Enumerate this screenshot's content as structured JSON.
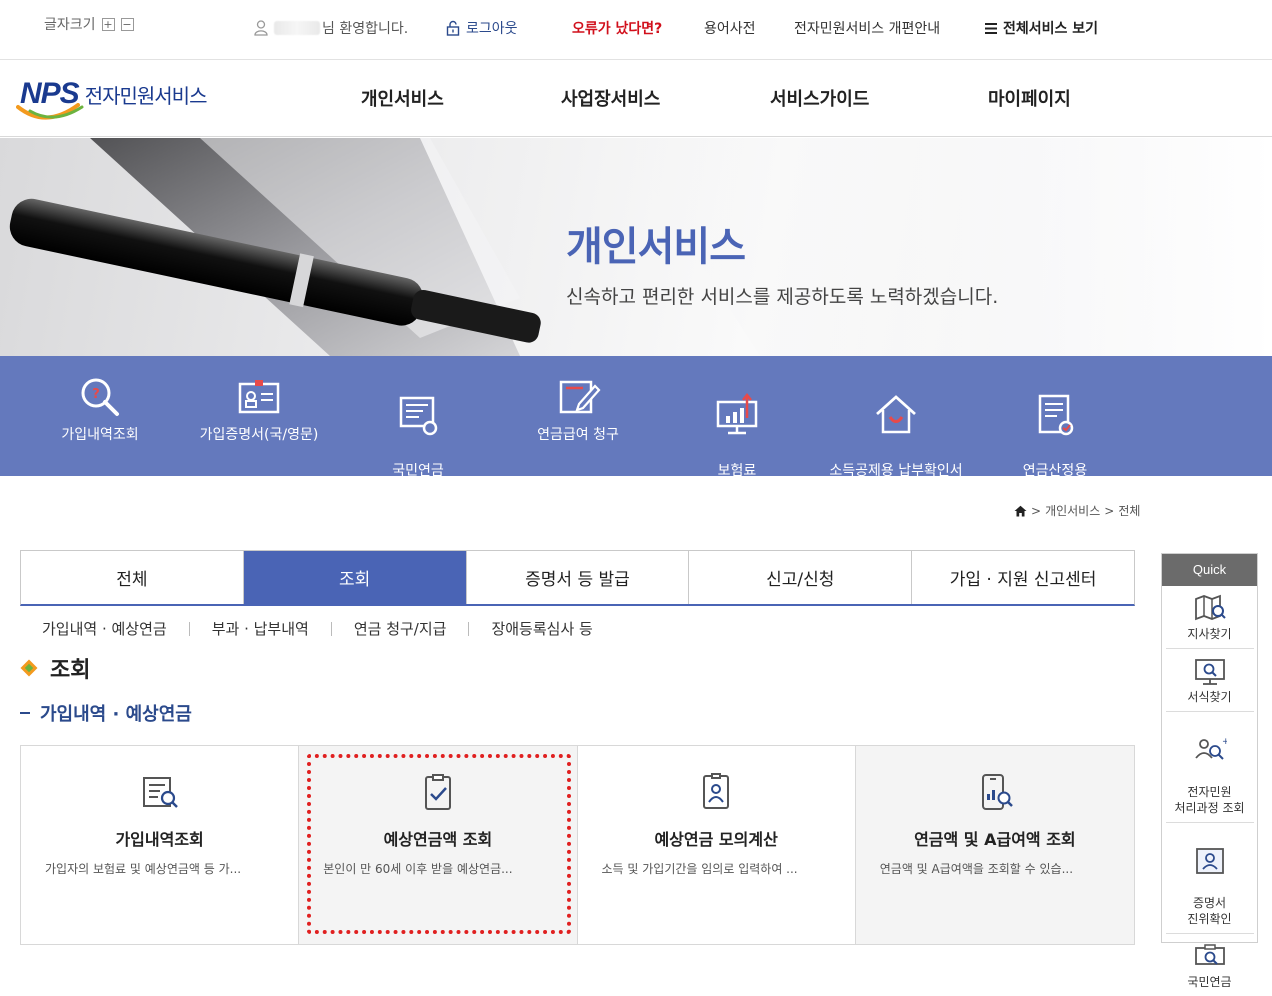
{
  "top": {
    "font_size_label": "글자크기",
    "font_plus": "+",
    "font_minus": "−",
    "welcome_text": "님 환영합니다.",
    "logout": "로그아웃",
    "error_link": "오류가 났다면?",
    "glossary": "용어사전",
    "renewal": "전자민원서비스 개편안내",
    "all_services": "전체서비스 보기"
  },
  "header": {
    "logo_mark": "NPS",
    "logo_text": "전자민원서비스",
    "nav": [
      "개인서비스",
      "사업장서비스",
      "서비스가이드",
      "마이페이지"
    ]
  },
  "hero": {
    "title": "개인서비스",
    "subtitle": "신속하고 편리한 서비스를 제공하도록 노력하겠습니다."
  },
  "quick_links": [
    {
      "label": "가입내역조회",
      "icon": "magnifier-icon"
    },
    {
      "label": "가입증명서(국/영문)",
      "icon": "id-card-icon"
    },
    {
      "label": "국민연금\n찾아가세요",
      "icon": "document-search-icon"
    },
    {
      "label": "연금급여 청구",
      "icon": "pen-form-icon"
    },
    {
      "label": "보험료\n결정내역(개인)",
      "icon": "chart-monitor-icon"
    },
    {
      "label": "소득공제용 납부확인서\n(개인)조회/증명",
      "icon": "house-icon"
    },
    {
      "label": "연금산정용\n가입내역확인서(국/영문)",
      "icon": "certificate-icon"
    }
  ],
  "breadcrumb": {
    "level1": "개인서비스",
    "level2": "전체"
  },
  "tabs": [
    "전체",
    "조회",
    "증명서 등 발급",
    "신고/신청",
    "가입 · 지원 신고센터"
  ],
  "active_tab": "조회",
  "subtabs": [
    "가입내역 · 예상연금",
    "부과 · 납부내역",
    "연금 청구/지급",
    "장애등록심사 등"
  ],
  "section_title": "조회",
  "subsection_title": "가입내역 · 예상연금",
  "cards": [
    {
      "title": "가입내역조회",
      "desc": "가입자의 보험료 및 예상연금액 등 가...",
      "icon": "document-search-icon"
    },
    {
      "title": "예상연금액 조회",
      "desc": "본인이 만 60세 이후 받을 예상연금...",
      "icon": "clipboard-check-icon"
    },
    {
      "title": "예상연금 모의계산",
      "desc": "소득 및 가입기간을 임의로 입력하여 ...",
      "icon": "profile-card-icon"
    },
    {
      "title": "연금액 및 A급여액 조회",
      "desc": "연금액 및 A급여액을 조회할 수 있습...",
      "icon": "phone-chart-icon"
    }
  ],
  "quick": {
    "title": "Quick",
    "items": [
      "지사찾기",
      "서식찾기",
      "전자민원\n처리과정 조회",
      "증명서\n진위확인",
      "국민연금"
    ]
  },
  "colors": {
    "brand_blue": "#4a64b5",
    "quickbar_bg": "#6479bd",
    "error_red": "#d10f1b",
    "highlight_red": "#e02020"
  }
}
